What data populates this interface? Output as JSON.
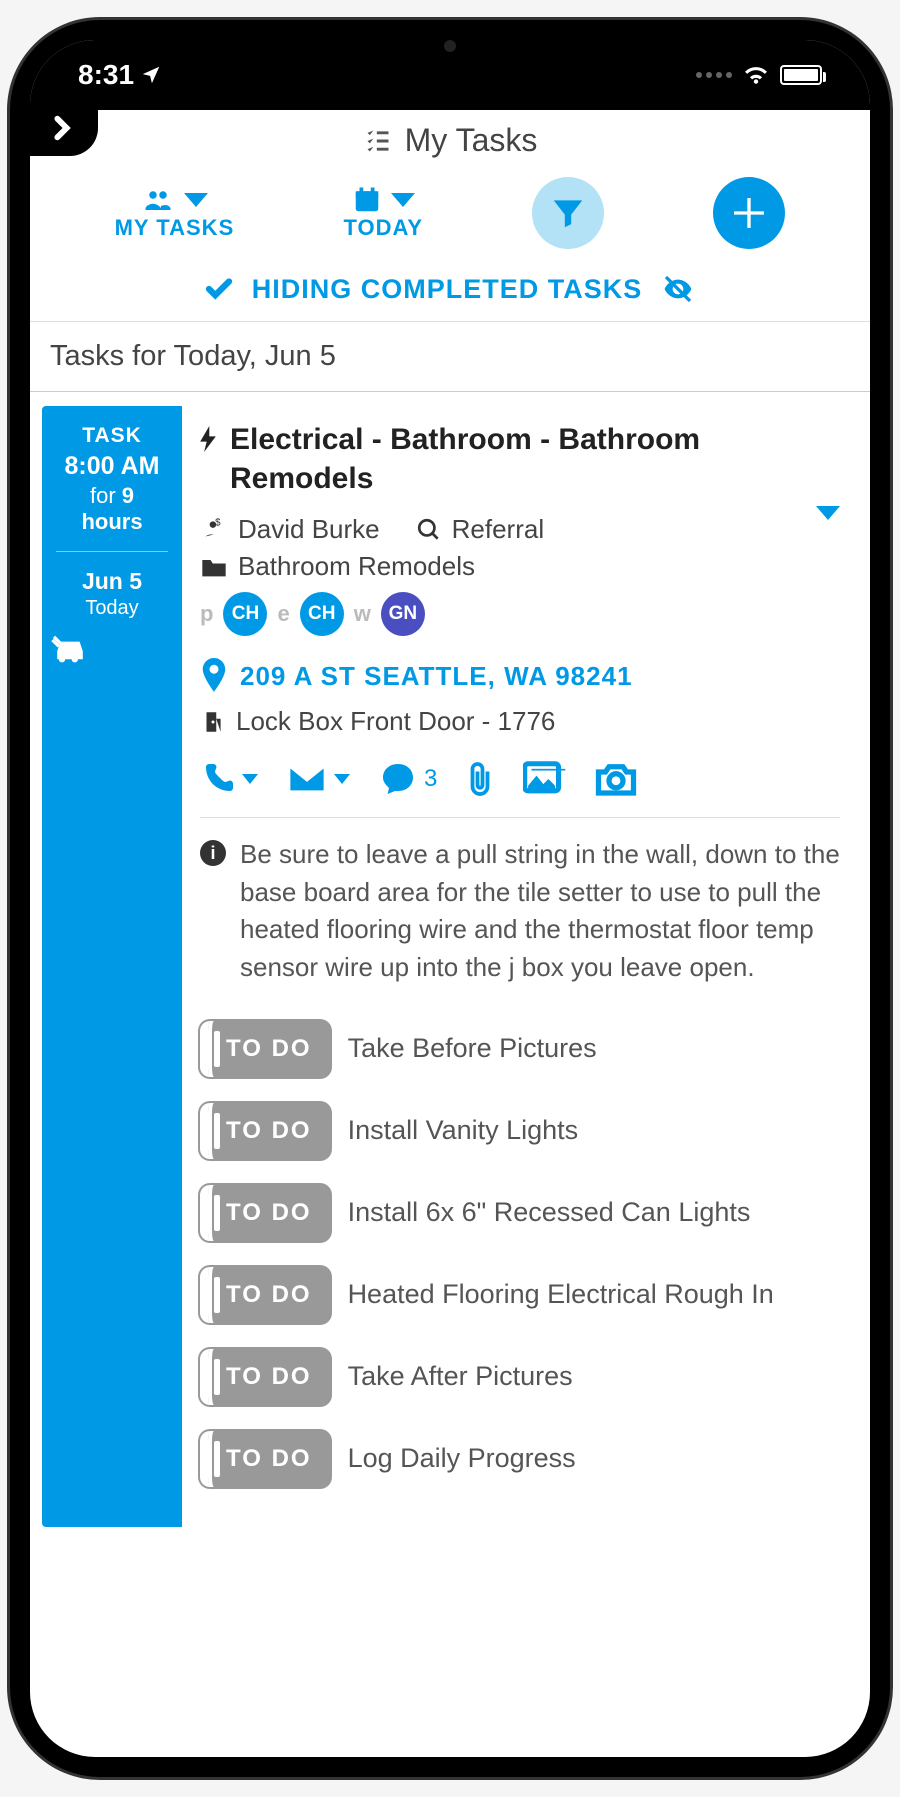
{
  "status": {
    "time": "8:31"
  },
  "header": {
    "title": "My Tasks"
  },
  "filters": {
    "group": "MY TASKS",
    "date": "TODAY"
  },
  "hiding_label": "HIDING COMPLETED TASKS",
  "date_header": "Tasks for Today, Jun 5",
  "task": {
    "label": "TASK",
    "time": "8:00 AM",
    "duration_prefix": "for ",
    "duration_value": "9",
    "duration_unit": "hours",
    "date": "Jun 5",
    "date_sub": "Today",
    "title": "Electrical - Bathroom - Bathroom Remodels",
    "customer": "David Burke",
    "source": "Referral",
    "project": "Bathroom Remodels",
    "badges": [
      {
        "prefix": "p",
        "text": "CH",
        "class": "ch"
      },
      {
        "prefix": "e",
        "text": "CH",
        "class": "ch"
      },
      {
        "prefix": "w",
        "text": "GN",
        "class": "gn"
      }
    ],
    "address": "209 A ST SEATTLE, WA 98241",
    "lockbox": "Lock Box Front Door - 1776",
    "chat_count": "3",
    "note": "Be sure to leave a pull string in the wall, down to the base board area for the tile setter to use to pull the heated flooring wire and the thermostat floor temp sensor wire up into the j box you leave open.",
    "todo_button": "TO DO",
    "todos": [
      "Take Before Pictures",
      "Install Vanity Lights",
      "Install 6x 6\" Recessed Can Lights",
      "Heated Flooring Electrical Rough In",
      "Take After Pictures",
      "Log Daily Progress"
    ]
  }
}
